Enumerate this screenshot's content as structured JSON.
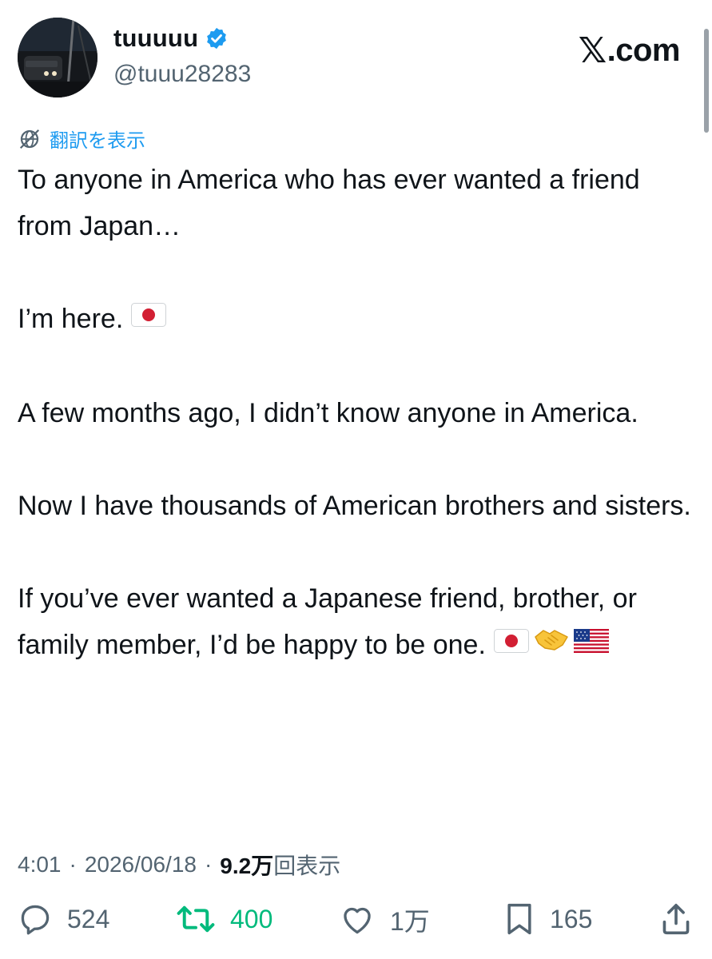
{
  "author": {
    "display_name": "tuuuuu",
    "handle": "@tuuu28283",
    "verified": true
  },
  "brand": {
    "logo_text": ".com",
    "logo_glyph": "𝕏"
  },
  "translate": {
    "label": "翻訳を表示",
    "icon": "globe-slash-icon"
  },
  "tweet": {
    "paragraphs": [
      "To anyone in America who has ever wanted a friend from Japan…",
      "I’m here.",
      "A few months ago, I didn’t know anyone in America.",
      "Now I have thousands of American brothers and sisters.",
      "If you’ve ever wanted a Japanese friend, brother, or family member, I’d be happy to be one."
    ],
    "emojis": [
      "japan-flag",
      "handshake",
      "us-flag"
    ]
  },
  "meta": {
    "time": "4:01",
    "separator": "·",
    "date": "2026/06/18",
    "views_count": "9.2万",
    "views_label": "回表示"
  },
  "actions": {
    "replies": "524",
    "retweets": "400",
    "likes": "1万",
    "bookmarks": "165"
  },
  "colors": {
    "accent": "#1d9bf0",
    "retweet_active": "#00ba7c",
    "secondary_text": "#536471",
    "primary_text": "#0f1419"
  }
}
